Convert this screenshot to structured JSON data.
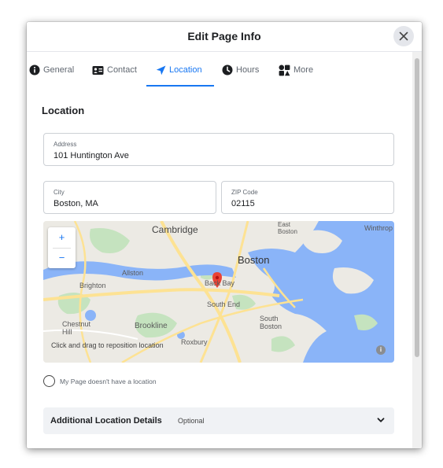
{
  "dialog": {
    "title": "Edit Page Info",
    "close_icon": "close-icon"
  },
  "tabs": [
    {
      "label": "General",
      "icon": "info-icon",
      "active": false
    },
    {
      "label": "Contact",
      "icon": "contact-card-icon",
      "active": false
    },
    {
      "label": "Location",
      "icon": "location-arrow-icon",
      "active": true
    },
    {
      "label": "Hours",
      "icon": "clock-icon",
      "active": false
    },
    {
      "label": "More",
      "icon": "more-apps-icon",
      "active": false
    }
  ],
  "section": {
    "title": "Location"
  },
  "address": {
    "label": "Address",
    "value": "101 Huntington Ave"
  },
  "city": {
    "label": "City",
    "value": "Boston, MA"
  },
  "zip": {
    "label": "ZIP Code",
    "value": "02115"
  },
  "map": {
    "zoom_in": "+",
    "zoom_out": "−",
    "labels": {
      "cambridge": "Cambridge",
      "east_boston": "East\nBoston",
      "winthrop": "Winthrop",
      "boston": "Boston",
      "allston": "Allston",
      "brighton": "Brighton",
      "back_bay": "Back Bay",
      "south_end": "South End",
      "chestnut_hill": "Chestnut\nHill",
      "brookline": "Brookline",
      "south_boston": "South\nBoston",
      "roxbury": "Roxbury"
    },
    "hint": "Click and drag to reposition location",
    "info": "i",
    "colors": {
      "water": "#8ab4f8",
      "land": "#eceae4",
      "park": "#c5e3bf",
      "road": "#fde293",
      "pin": "#ea4335"
    }
  },
  "no_location": {
    "label": "My Page doesn't have a location"
  },
  "additional": {
    "title": "Additional Location Details",
    "optional": "Optional"
  },
  "colors": {
    "accent": "#1877f2"
  }
}
